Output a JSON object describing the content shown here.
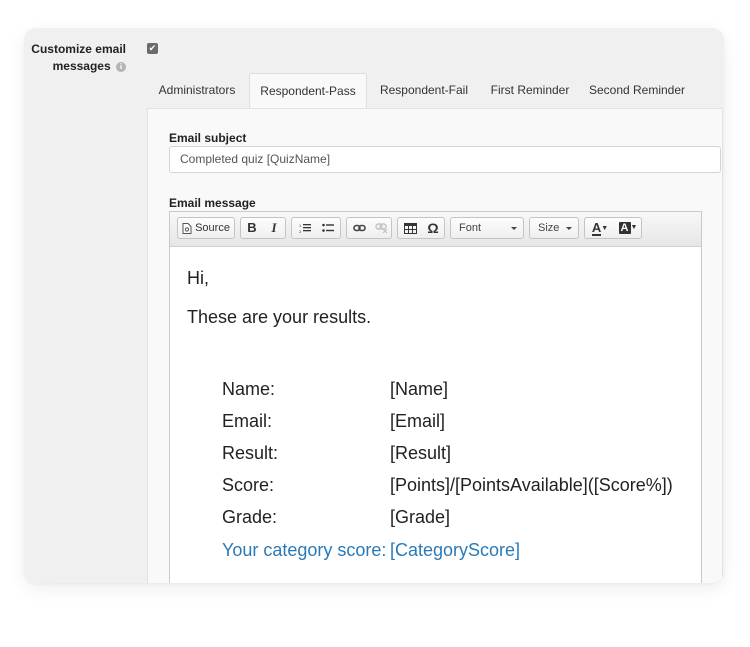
{
  "option": {
    "label": "Customize email messages",
    "checked": true,
    "info_icon": "info-icon"
  },
  "tabs": [
    {
      "label": "Administrators",
      "active": false
    },
    {
      "label": "Respondent-Pass",
      "active": true
    },
    {
      "label": "Respondent-Fail",
      "active": false
    },
    {
      "label": "First Reminder",
      "active": false
    },
    {
      "label": "Second Reminder",
      "active": false
    }
  ],
  "subject": {
    "label": "Email subject",
    "value": "Completed quiz [QuizName]"
  },
  "message": {
    "label": "Email message",
    "toolbar": {
      "source_label": "Source",
      "bold_label": "B",
      "italic_label": "I",
      "special_char_label": "Ω",
      "font_label": "Font",
      "size_label": "Size",
      "text_color_label": "A",
      "bg_color_label": "A"
    },
    "greeting": "Hi,",
    "intro": "These are your results.",
    "rows": [
      {
        "label": "Name:",
        "value": "[Name]"
      },
      {
        "label": "Email:",
        "value": "[Email]"
      },
      {
        "label": "Result:",
        "value": "[Result]"
      },
      {
        "label": "Score:",
        "value": "[Points]/[PointsAvailable]([Score%])"
      },
      {
        "label": "Grade:",
        "value": "[Grade]"
      },
      {
        "label": "Your category score:",
        "value": "[CategoryScore]"
      }
    ],
    "category_color": "#2a7ab8"
  }
}
